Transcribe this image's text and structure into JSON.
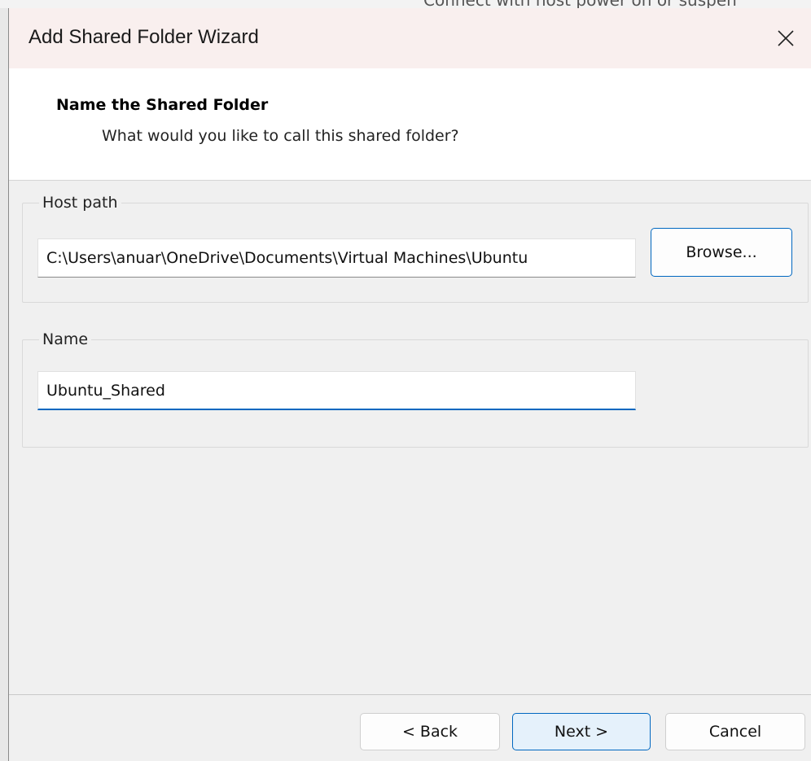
{
  "background": {
    "text": "Connect with host power on or suspen"
  },
  "window": {
    "title": "Add Shared Folder Wizard",
    "close_icon": "close-icon"
  },
  "header": {
    "title": "Name the Shared Folder",
    "subtitle": "What would you like to call this shared folder?"
  },
  "host_path": {
    "label": "Host path",
    "value": "C:\\Users\\anuar\\OneDrive\\Documents\\Virtual Machines\\Ubuntu",
    "browse_label": "Browse..."
  },
  "name": {
    "label": "Name",
    "value": "Ubuntu_Shared"
  },
  "footer": {
    "back_label": "< Back",
    "next_label": "Next >",
    "cancel_label": "Cancel"
  },
  "colors": {
    "accent": "#0067c0",
    "titlebar": "#f9efee"
  }
}
